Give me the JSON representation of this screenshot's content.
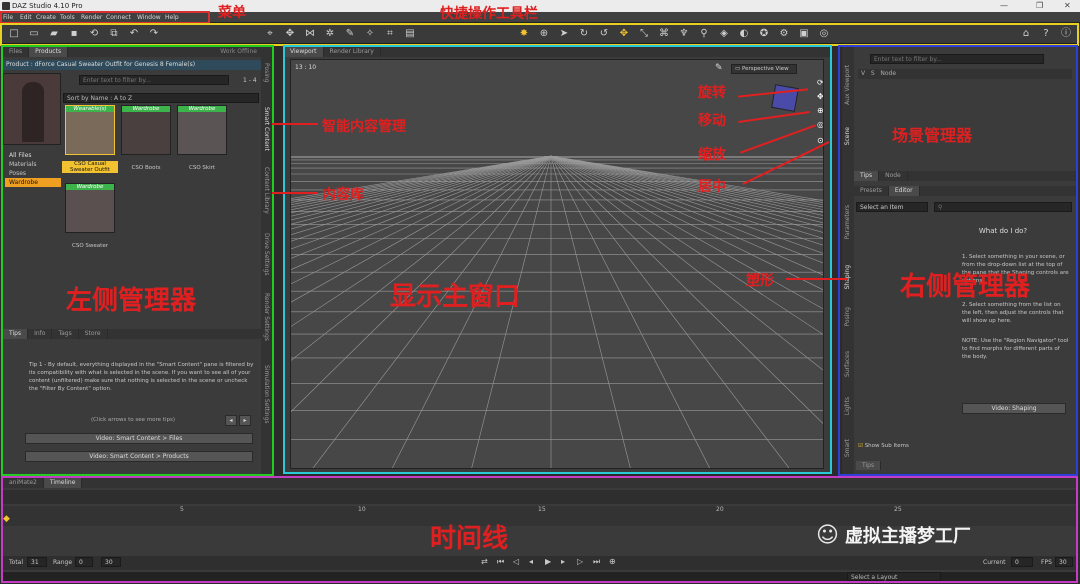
{
  "app": {
    "title": "DAZ Studio 4.10 Pro"
  },
  "menu": [
    "File",
    "Edit",
    "Create",
    "Tools",
    "Render",
    "Connect",
    "Window",
    "Help"
  ],
  "left_panel": {
    "tabs": [
      "Files",
      "Products"
    ],
    "work_offline": "Work Offline",
    "product_title": "Product : dForce Casual Sweater Outfit for Genesis 8 Female(s)",
    "filter_placeholder": "Enter text to filter by...",
    "count": "1 - 4",
    "sort": "Sort by Name : A to Z",
    "categories": [
      "All Files",
      "Materials",
      "Poses",
      "Wardrobe"
    ],
    "thumbnails": [
      {
        "badge": "Wearable(s)",
        "label": "CSO Casual Sweater Outfit"
      },
      {
        "badge": "Wardrobe",
        "label": "CSO Boots"
      },
      {
        "badge": "Wardrobe",
        "label": "CSO Skirt"
      },
      {
        "badge": "Wardrobe",
        "label": "CSO Sweater"
      }
    ],
    "side_tabs": [
      "Posing",
      "Smart Content",
      "Content Library",
      "Drive Settings",
      "Render Settings",
      "Simulation Settings"
    ],
    "tip_tabs": [
      "Tips",
      "Info",
      "Tags",
      "Store"
    ],
    "tip_text": "Tip 1 - By default, everything displayed in the \"Smart Content\" pane is filtered by its compatibility with what is selected in the scene. If you want to see all of your content (unfiltered) make sure that nothing is selected in the scene or uncheck the \"Filter By Content\" option.",
    "tip_nav": "(Click arrows to see more tips)",
    "video_buttons": [
      "Video: Smart Content > Files",
      "Video: Smart Content > Products"
    ]
  },
  "viewport": {
    "tabs": [
      "Viewport",
      "Render Library"
    ],
    "coords": "13 : 10",
    "view": "Perspective View"
  },
  "right_panel": {
    "filter_placeholder": "Enter text to filter by...",
    "scene_cols": [
      "V",
      "S",
      "Node"
    ],
    "side_tabs": [
      "Aux Viewport",
      "Scene",
      "Parameters",
      "Shaping",
      "Posing",
      "Surfaces",
      "Lights",
      "Smart"
    ],
    "tabs": [
      "Tips",
      "Node"
    ],
    "subtabs": [
      "Presets",
      "Editor"
    ],
    "select_item": "Select an Item",
    "what_title": "What do I do?",
    "step1": "1. Select something in your scene, or from the drop-down list at the top of the pane that the Shaping controls are options.",
    "step2": "2. Select something from the list on the left, then adjust the controls that will show up here.",
    "note": "NOTE: Use the \"Region Navigator\" tool to find morphs for different parts of the body.",
    "video": "Video: Shaping",
    "show_sub": "Show Sub Items",
    "bottom_tab": "Tips"
  },
  "timeline": {
    "tabs": [
      "aniMate2",
      "Timeline"
    ],
    "ticks": [
      "0",
      "5",
      "10",
      "15",
      "20",
      "25"
    ],
    "total_label": "Total",
    "total": "31",
    "range_label": "Range",
    "range_start": "0",
    "range_end": "30",
    "current_label": "Current",
    "current": "0",
    "fps_label": "FPS",
    "fps": "30",
    "layout": "Select a Layout"
  },
  "annotations": {
    "menu": "菜单",
    "toolbar": "快捷操作工具栏",
    "smart_content": "智能内容管理",
    "content_library": "内容库",
    "left_manager": "左侧管理器",
    "main_window": "显示主窗口",
    "rotate": "旋转",
    "move": "移动",
    "zoom": "缩放",
    "center": "居中",
    "shaping": "塑形",
    "scene_manager": "场景管理器",
    "right_manager": "右侧管理器",
    "timeline": "时间线",
    "watermark": "虚拟主播梦工厂"
  },
  "colors": {
    "menu_frame": "#d83030",
    "toolbar_frame": "#e8d020",
    "left_frame": "#22cc22",
    "viewport_frame": "#29c9d8",
    "right_frame": "#2f3fd8",
    "timeline_frame": "#c53cc5",
    "annotation": "#e02020",
    "accent": "#f2c230"
  }
}
